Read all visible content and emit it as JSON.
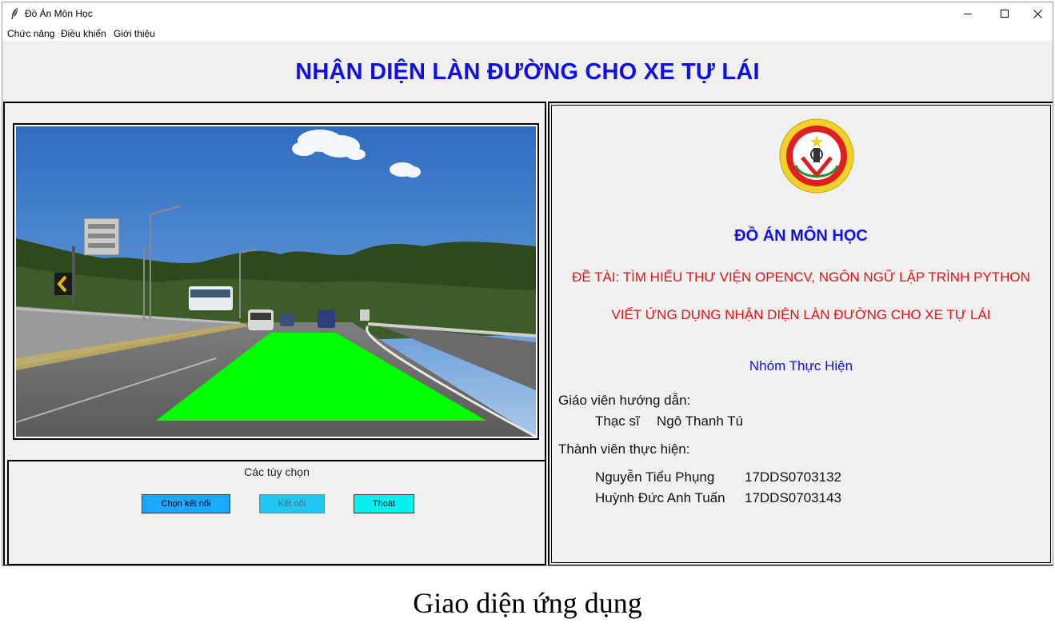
{
  "window": {
    "title": "Đồ Án Môn Học"
  },
  "menu": {
    "items": [
      "Chức năng",
      "Điều khiển",
      "Giới thiệu"
    ]
  },
  "header": {
    "title": "NHẬN DIỆN LÀN ĐƯỜNG CHO XE TỰ LÁI",
    "title_color": "#1010e6"
  },
  "options": {
    "title": "Các tùy chọn",
    "buttons": {
      "select_connection": "Chọn kết nối",
      "connect": "Kết nối",
      "exit": "Thoát"
    }
  },
  "info_panel": {
    "logo_text": "TỔNG CỤC KỸ THUẬT",
    "course_title": "ĐỒ ÁN MÔN HỌC",
    "topic_line_1": "ĐỀ TÀI: TÌM HIỂU THƯ VIỆN OPENCV, NGÔN NGỮ LẬP TRÌNH PYTHON",
    "topic_line_2": "VIẾT ỨNG DỤNG NHẬN DIỆN LÀN ĐƯỜNG CHO XE TỰ LÁI",
    "group_label": "Nhóm Thực Hiện",
    "advisor_label": "Giáo viên hướng dẫn:",
    "advisor_title": "Thạc sĩ",
    "advisor_name": "Ngô Thanh Tú",
    "members_label": "Thành viên thực hiện:",
    "members": [
      {
        "name": "Nguyễn Tiểu Phụng",
        "id": "17DDS0703132"
      },
      {
        "name": "Huỳnh Đức Anh Tuấn",
        "id": "17DDS0703143"
      }
    ]
  },
  "colors": {
    "lane_overlay": "#00ff00",
    "topic_red": "#e81010",
    "button_select": "#1aa9ff",
    "button_connect": "#1ec8f0",
    "button_exit": "#0af0f0"
  },
  "caption": "Giao diện ứng dụng"
}
